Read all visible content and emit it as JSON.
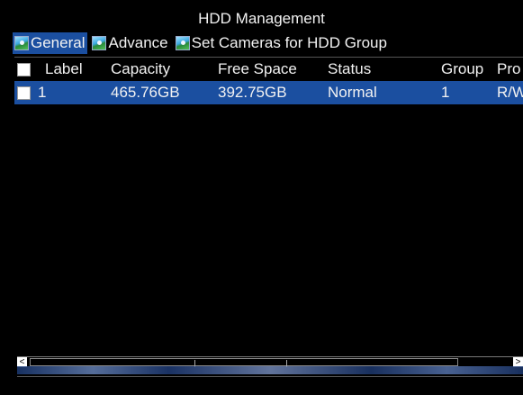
{
  "window": {
    "title": "HDD Management"
  },
  "tabs": [
    {
      "label": "General",
      "icon": "tab-image-icon",
      "active": true
    },
    {
      "label": "Advance",
      "icon": "tab-image-icon",
      "active": false
    },
    {
      "label": "Set Cameras for HDD Group",
      "icon": "tab-image-icon",
      "active": false
    }
  ],
  "table": {
    "columns": {
      "label": "Label",
      "capacity": "Capacity",
      "free_space": "Free Space",
      "status": "Status",
      "group": "Group",
      "property": "Pro"
    },
    "rows": [
      {
        "label": "1",
        "capacity": "465.76GB",
        "free_space": "392.75GB",
        "status": "Normal",
        "group": "1",
        "property": "R/W",
        "selected": true
      }
    ]
  },
  "scrollbar": {
    "left_arrow": "<",
    "right_arrow": ">"
  },
  "colors": {
    "background": "#000000",
    "selection": "#1b4fa0",
    "text": "#f2f2f2"
  }
}
